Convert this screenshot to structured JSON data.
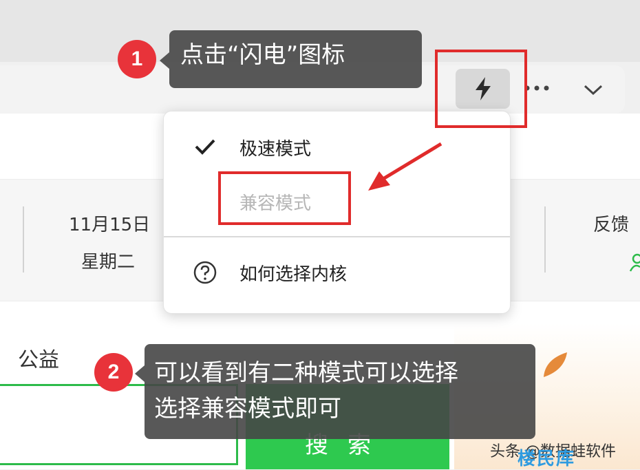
{
  "tooltips": {
    "step1": {
      "number": "1",
      "text": "点击“闪电”图标"
    },
    "step2": {
      "number": "2",
      "line1": "可以看到有二种模式可以选择",
      "line2": "选择兼容模式即可"
    }
  },
  "toolbar": {
    "flash_icon": "lightning-icon",
    "more_icon": "more-dots-icon",
    "dropdown_icon": "chevron-down-icon"
  },
  "kernel_menu": {
    "items": [
      {
        "label": "极速模式",
        "checked": true
      },
      {
        "label": "兼容模式",
        "checked": false
      },
      {
        "label": "如何选择内核",
        "icon": "help-icon"
      }
    ]
  },
  "page": {
    "date": "11月15日",
    "weekday": "星期二",
    "feedback": "反馈",
    "gongyi": "公益",
    "search_button": "搜索"
  },
  "watermark": {
    "line1": "头条 @数据蛙软件",
    "line2": "楼民库"
  },
  "colors": {
    "highlight": "#e02b2b",
    "step_badge": "#e8333a",
    "tooltip_bg": "#464646",
    "search_green": "#2ec94f"
  }
}
